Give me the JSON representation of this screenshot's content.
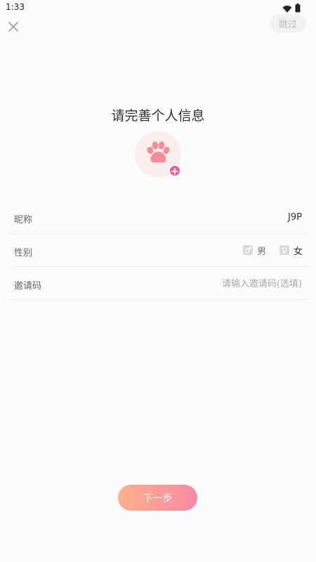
{
  "status_bar": {
    "time": "1:33",
    "icons": [
      "wifi-icon",
      "battery-icon"
    ]
  },
  "top_bar": {
    "close_icon": "close-icon",
    "skip_label": "跳过"
  },
  "title": "请完善个人信息",
  "avatar": {
    "icon": "paw-icon",
    "badge_icon": "add-icon"
  },
  "form": {
    "nickname": {
      "label": "昵称",
      "value": "J9P"
    },
    "gender": {
      "label": "性别",
      "options": [
        {
          "label": "男",
          "icon": "male-icon"
        },
        {
          "label": "女",
          "icon": "female-icon"
        }
      ]
    },
    "invite": {
      "label": "邀请码",
      "value": "",
      "placeholder": "请输入邀请码(选填)"
    }
  },
  "next_button": "下一步",
  "colors": {
    "accent": "#f15b8f",
    "button_gradient_start": "#fcb08d",
    "button_gradient_end": "#f98aa5",
    "avatar_bg": "#fdeeee",
    "background": "#fdfcfd"
  }
}
